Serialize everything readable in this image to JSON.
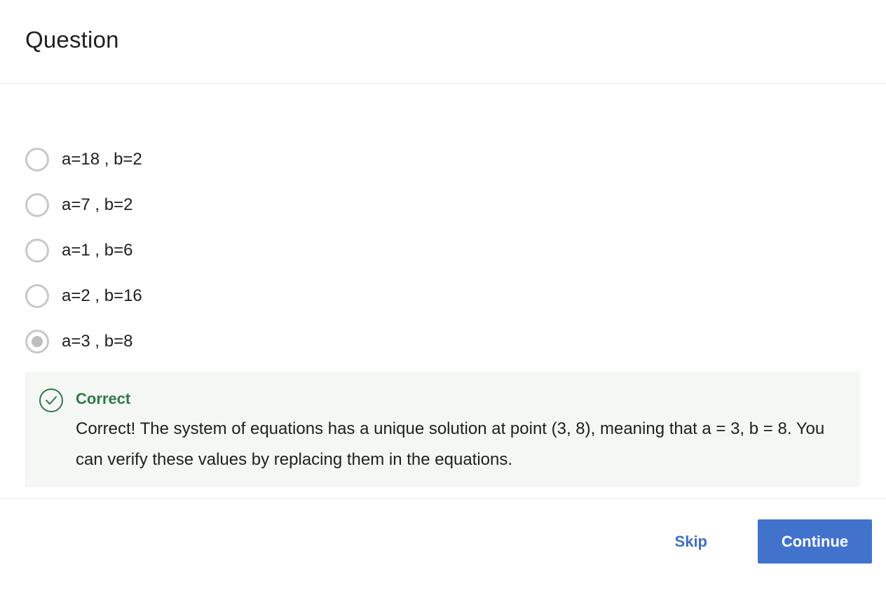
{
  "header": {
    "title": "Question"
  },
  "options": [
    {
      "label": "a=18 , b=2",
      "selected": false
    },
    {
      "label": "a=7 , b=2",
      "selected": false
    },
    {
      "label": "a=1 , b=6",
      "selected": false
    },
    {
      "label": "a=2 , b=16",
      "selected": false
    },
    {
      "label": "a=3 , b=8",
      "selected": true
    }
  ],
  "feedback": {
    "status": "Correct",
    "message": "Correct! The system of equations has a unique solution at point (3, 8), meaning that a = 3, b = 8. You can verify these values by replacing them in the equations.",
    "icon": "check-circle-icon",
    "color": "#2f7a47"
  },
  "footer": {
    "skip_label": "Skip",
    "continue_label": "Continue"
  },
  "colors": {
    "accent": "#4172cc",
    "success": "#2f7a47"
  }
}
